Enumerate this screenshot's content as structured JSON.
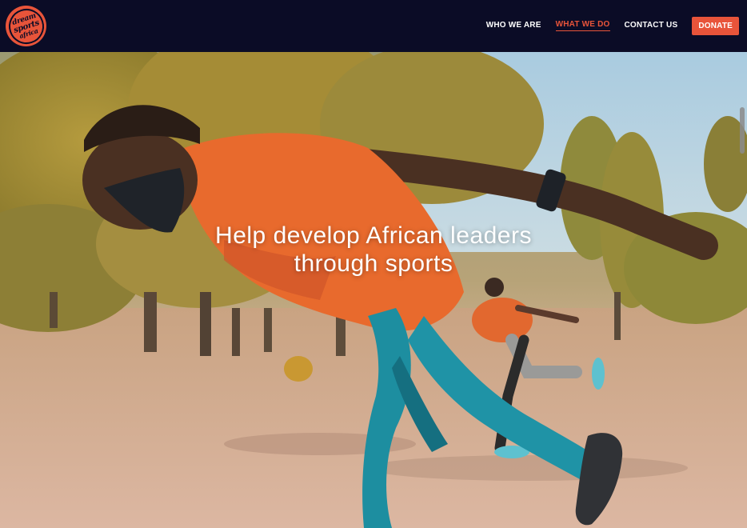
{
  "logo": {
    "alt": "Dream Sports Africa",
    "lines": [
      "dream",
      "sports",
      "africa"
    ]
  },
  "nav": {
    "items": [
      {
        "label": "WHO WE ARE",
        "active": false
      },
      {
        "label": "WHAT WE DO",
        "active": true
      },
      {
        "label": "CONTACT US",
        "active": false
      }
    ],
    "donate_label": "DONATE"
  },
  "hero": {
    "headline_line1": "Help develop African leaders",
    "headline_line2": "through sports"
  },
  "colors": {
    "accent": "#e8543a",
    "navbar": "#0b0c26"
  }
}
